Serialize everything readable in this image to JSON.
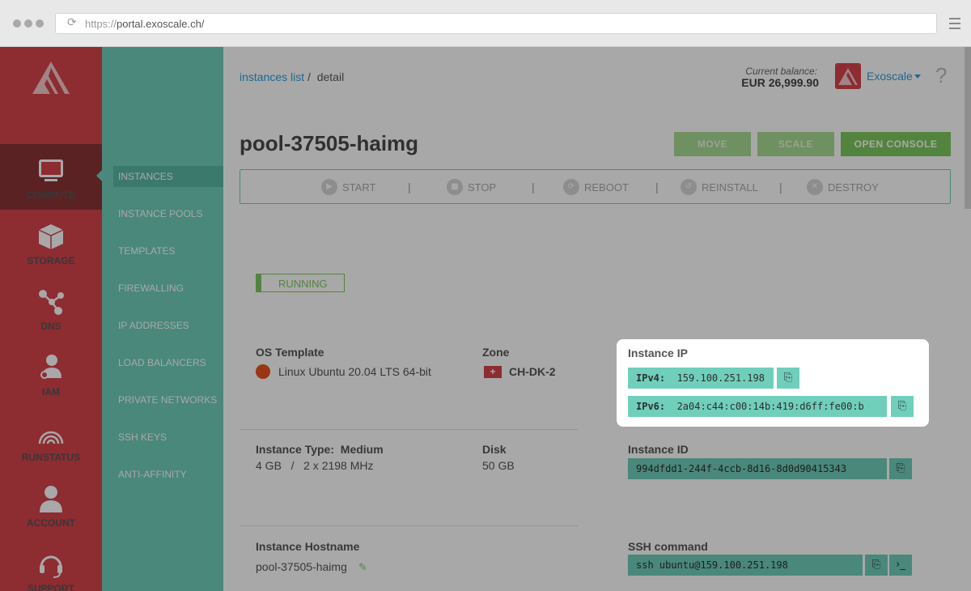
{
  "browser": {
    "url_proto": "https://",
    "url_host": "portal.exoscale.ch/"
  },
  "nav": {
    "items": [
      {
        "label": "COMPUTE",
        "icon": "monitor-icon"
      },
      {
        "label": "STORAGE",
        "icon": "cube-icon"
      },
      {
        "label": "DNS",
        "icon": "network-icon"
      },
      {
        "label": "IAM",
        "icon": "user-key-icon"
      },
      {
        "label": "RUNSTATUS",
        "icon": "signal-icon"
      },
      {
        "label": "ACCOUNT",
        "icon": "user-icon"
      },
      {
        "label": "SUPPORT",
        "icon": "headset-icon"
      }
    ]
  },
  "subnav": {
    "items": [
      "INSTANCES",
      "INSTANCE POOLS",
      "TEMPLATES",
      "FIREWALLING",
      "IP ADDRESSES",
      "LOAD BALANCERS",
      "PRIVATE NETWORKS",
      "SSH KEYS",
      "ANTI-AFFINITY"
    ]
  },
  "header": {
    "crumb_link": "instances list",
    "crumb_sep": "/",
    "crumb_current": "detail",
    "balance_label": "Current balance:",
    "balance_value": "EUR 26,999.90",
    "account_name": "Exoscale",
    "help": "?"
  },
  "instance": {
    "name": "pool-37505-haimg",
    "buttons": {
      "move": "MOVE",
      "scale": "SCALE",
      "console": "OPEN CONSOLE"
    },
    "actions": {
      "start": "START",
      "stop": "STOP",
      "reboot": "REBOOT",
      "reinstall": "REINSTALL",
      "destroy": "DESTROY",
      "sep": "|"
    },
    "status": "RUNNING",
    "os_label": "OS Template",
    "os_value": "Linux Ubuntu 20.04 LTS 64-bit",
    "zone_label": "Zone",
    "zone_value": "CH-DK-2",
    "ip_label": "Instance IP",
    "ipv4_key": "IPv4:",
    "ipv4_value": "159.100.251.198",
    "ipv6_key": "IPv6:",
    "ipv6_value": "2a04:c44:c00:14b:419:d6ff:fe00:b",
    "type_label": "Instance Type:",
    "type_value": "Medium",
    "type_spec": "4 GB   /   2 x 2198 MHz",
    "disk_label": "Disk",
    "disk_value": "50 GB",
    "id_label": "Instance ID",
    "id_value": "994dfdd1-244f-4ccb-8d16-8d0d90415343",
    "hostname_label": "Instance Hostname",
    "hostname_value": "pool-37505-haimg",
    "ssh_label": "SSH command",
    "ssh_value": "ssh ubuntu@159.100.251.198"
  },
  "colors": {
    "nav_red": "#d7434b",
    "teal": "#6fcfbb",
    "green": "#7ec85e",
    "link_blue": "#2f9fd8"
  }
}
